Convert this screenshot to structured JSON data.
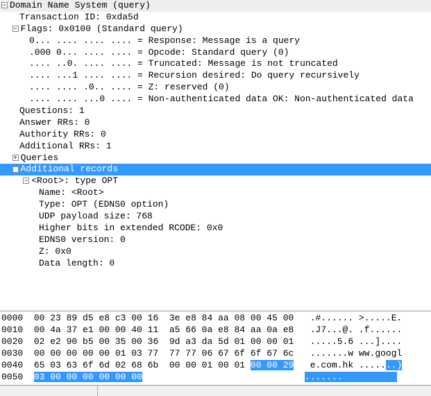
{
  "tree": {
    "dns_header": "Domain Name System (query)",
    "transaction_id": "Transaction ID: 0xda5d",
    "flags_header": "Flags: 0x0100 (Standard query)",
    "flag_bits": [
      "0... .... .... .... = Response: Message is a query",
      ".000 0... .... .... = Opcode: Standard query (0)",
      ".... ..0. .... .... = Truncated: Message is not truncated",
      ".... ...1 .... .... = Recursion desired: Do query recursively",
      ".... .... .0.. .... = Z: reserved (0)",
      ".... .... ...0 .... = Non-authenticated data OK: Non-authenticated data"
    ],
    "questions": "Questions: 1",
    "answer_rrs": "Answer RRs: 0",
    "authority_rrs": "Authority RRs: 0",
    "additional_rrs": "Additional RRs: 1",
    "queries": "Queries",
    "additional_records": "Additional records",
    "root_header": "<Root>: type OPT",
    "root_fields": [
      "Name: <Root>",
      "Type: OPT (EDNS0 option)",
      "UDP payload size: 768",
      "Higher bits in extended RCODE: 0x0",
      "EDNS0 version: 0",
      "Z: 0x0",
      "Data length: 0"
    ]
  },
  "hex": {
    "rows": [
      {
        "off": "0000",
        "b1": "00 23 89 d5 e8 c3 00 16",
        "b2": "3e e8 84 aa 08 00 45 00",
        "ascii": ".#...... >.....E."
      },
      {
        "off": "0010",
        "b1": "00 4a 37 e1 00 00 40 11",
        "b2": "a5 66 0a e8 84 aa 0a e8",
        "ascii": ".J7...@. .f......"
      },
      {
        "off": "0020",
        "b1": "02 e2 90 b5 00 35 00 36",
        "b2": "9d a3 da 5d 01 00 00 01",
        "ascii": ".....5.6 ...]...."
      },
      {
        "off": "0030",
        "b1": "00 00 00 00 00 01 03 77",
        "b2": "77 77 06 67 6f 6f 67 6c",
        "ascii": ".......w ww.googl"
      }
    ],
    "row40": {
      "off": "0040",
      "b1": "65 03 63 6f 6d 02 68 6b",
      "b2a": "00 00 01 00 01 ",
      "b2b": "00 00 29",
      "ascii_a": "e.com.hk .....",
      "ascii_b": "..)"
    },
    "row50": {
      "off": "0050",
      "b1": "03 00 00 00 00 00 00",
      "ascii": ".......          "
    }
  }
}
